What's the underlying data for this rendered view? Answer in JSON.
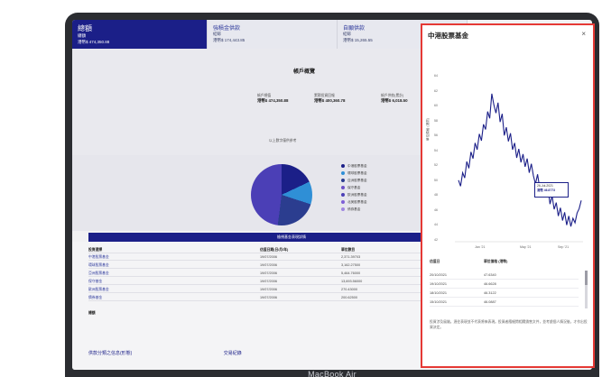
{
  "device": {
    "label": "MacBook Air"
  },
  "topbar": {
    "tabs": [
      {
        "title": "總額",
        "sub": "總額",
        "value": "港幣$ 474,350.88"
      },
      {
        "title": "強積金供款",
        "sub": "結餘",
        "value": "港幣$ 174,443.85"
      },
      {
        "title": "自願供款",
        "sub": "結餘",
        "value": "港幣$ 15,265.55"
      }
    ]
  },
  "account": {
    "title": "帳戶概覽",
    "stats": [
      {
        "label": "帳戶總值",
        "value": "港幣$ 474,350.88"
      },
      {
        "label": "累積投資回報",
        "value": "港幣$ 400,360.78"
      },
      {
        "label": "帳戶供款(累計)",
        "value": "港幣$ 6,018.50"
      }
    ],
    "note": "以上數字僅供參考"
  },
  "allocation": {
    "legend": [
      {
        "name": "中港股票基金",
        "pct": "7.39%",
        "color": "#1b1f88"
      },
      {
        "name": "環球股票基金",
        "pct": "14.57%",
        "color": "#2f8fd6"
      },
      {
        "name": "亞洲股票基金",
        "pct": "7.75%",
        "color": "#2b3d8f"
      },
      {
        "name": "保守基金",
        "pct": "10.81%",
        "color": "#6b4fc6"
      },
      {
        "name": "歐洲股票基金",
        "pct": "3.81%",
        "color": "#4b3fb6"
      },
      {
        "name": "北美股票基金",
        "pct": "3.81%",
        "color": "#7e5fd6"
      },
      {
        "name": "債券基金",
        "pct": "2.93%",
        "color": "#9f86e0"
      }
    ],
    "button_label": "檢視基金表現詳情"
  },
  "holdings": {
    "header": [
      "投資選擇",
      "估值日期(日/月/年)",
      "單位數目",
      "單位價格"
    ],
    "rows": [
      [
        "中港股票基金",
        "19/07/2006",
        "2,371.39703"
      ],
      [
        "環球股票基金",
        "19/07/2006",
        "3,162.27500"
      ],
      [
        "亞洲股票基金",
        "19/07/2006",
        "5,464.76000"
      ],
      [
        "保守基金",
        "19/07/2006",
        "13,693.56000"
      ],
      [
        "歐洲股票基金",
        "19/07/2006",
        "270.43000"
      ],
      [
        "債券基金",
        "19/07/2006",
        "200.62500"
      ]
    ],
    "total_label": "總額",
    "card1": "供款分類之信息(形態)",
    "card2": "交易紀錄"
  },
  "panel": {
    "title": "中港股票基金",
    "close": "×",
    "ylabel": "單位價格 (港幣)",
    "yticks": [
      "64",
      "62",
      "60",
      "58",
      "56",
      "54",
      "52",
      "50",
      "48",
      "46",
      "44",
      "42"
    ],
    "xticks": [
      "Jan '21",
      "May '21",
      "Sep '21"
    ],
    "tooltip": {
      "date": "26-Jul-2021",
      "value": "港幣 46.8773"
    },
    "table_header": [
      "估值日",
      "單位價格 (港幣)"
    ],
    "table_rows": [
      [
        "20/10/2021",
        "47.6340"
      ],
      [
        "19/10/2021",
        "46.6628"
      ],
      [
        "18/10/2021",
        "46.3122"
      ],
      [
        "15/10/2021",
        "46.0887"
      ]
    ],
    "footnote": "投資涉及風險。過往表現並不代表將來表現。投資者應細閱相關銷售文件，並考慮個人情況後，才作出投資決定。"
  },
  "chart_data": {
    "type": "line",
    "title": "中港股票基金",
    "ylabel": "單位價格 (港幣)",
    "ylim": [
      42,
      64
    ],
    "x_ticks": [
      "Jan '21",
      "May '21",
      "Sep '21"
    ],
    "series": [
      {
        "name": "中港股票基金",
        "values": [
          50.0,
          49.2,
          51.0,
          50.3,
          52.5,
          51.6,
          53.8,
          52.9,
          55.0,
          54.1,
          56.2,
          55.3,
          57.5,
          56.8,
          59.2,
          58.3,
          61.6,
          60.1,
          59.0,
          60.4,
          57.8,
          58.9,
          56.0,
          57.1,
          55.2,
          56.3,
          54.1,
          55.0,
          53.0,
          54.2,
          52.4,
          53.5,
          51.8,
          52.9,
          51.0,
          52.2,
          50.6,
          49.5,
          50.8,
          49.0,
          48.2,
          49.5,
          47.8,
          48.9,
          46.8,
          47.9,
          46.1,
          47.0,
          45.2,
          46.3,
          44.6,
          45.7,
          44.0,
          45.2,
          43.8,
          44.9,
          44.3,
          45.6,
          46.2,
          47.3
        ]
      }
    ]
  }
}
